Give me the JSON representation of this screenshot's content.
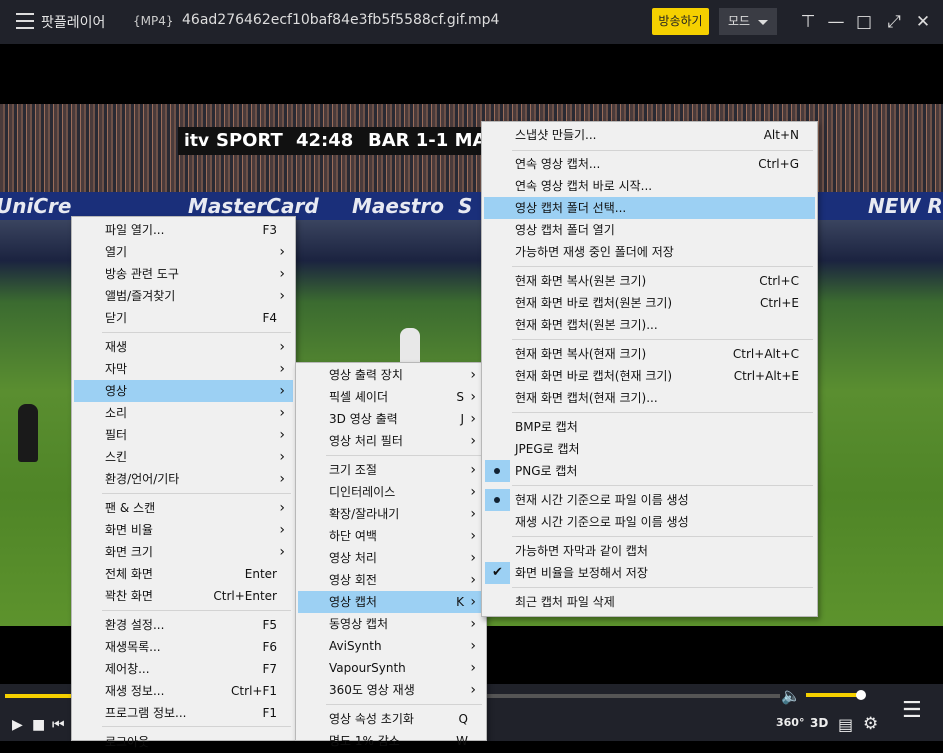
{
  "titlebar": {
    "app_name": "팟플레이어",
    "format": "{MP4}",
    "filename": "46ad276462ecf10baf84e3fb5f5588cf.gif.mp4",
    "broadcast_button": "방송하기",
    "mode_button": "모드"
  },
  "video": {
    "broadcaster": "itv",
    "sport_label": "SPORT",
    "clock": "42:48",
    "score": "BAR 1-1 MA",
    "ads": [
      "UniCre",
      "MasterCard",
      "Maestro",
      "S",
      "NEW R"
    ]
  },
  "menu_main": {
    "items": [
      {
        "label": "파일 열기...",
        "shortcut": "F3",
        "sub": false
      },
      {
        "label": "열기",
        "shortcut": "",
        "sub": true
      },
      {
        "label": "방송 관련 도구",
        "shortcut": "",
        "sub": true
      },
      {
        "label": "앨범/즐겨찾기",
        "shortcut": "",
        "sub": true
      },
      {
        "label": "닫기",
        "shortcut": "F4",
        "sub": false
      },
      {
        "label": "재생",
        "shortcut": "",
        "sub": true
      },
      {
        "label": "자막",
        "shortcut": "",
        "sub": true
      },
      {
        "label": "영상",
        "shortcut": "",
        "sub": true
      },
      {
        "label": "소리",
        "shortcut": "",
        "sub": true
      },
      {
        "label": "필터",
        "shortcut": "",
        "sub": true
      },
      {
        "label": "스킨",
        "shortcut": "",
        "sub": true
      },
      {
        "label": "환경/언어/기타",
        "shortcut": "",
        "sub": true
      },
      {
        "label": "팬 & 스캔",
        "shortcut": "",
        "sub": true
      },
      {
        "label": "화면 비율",
        "shortcut": "",
        "sub": true
      },
      {
        "label": "화면 크기",
        "shortcut": "",
        "sub": true
      },
      {
        "label": "전체 화면",
        "shortcut": "Enter",
        "sub": false
      },
      {
        "label": "꽉찬 화면",
        "shortcut": "Ctrl+Enter",
        "sub": false
      },
      {
        "label": "환경 설정...",
        "shortcut": "F5",
        "sub": false
      },
      {
        "label": "재생목록...",
        "shortcut": "F6",
        "sub": false
      },
      {
        "label": "제어창...",
        "shortcut": "F7",
        "sub": false
      },
      {
        "label": "재생 정보...",
        "shortcut": "Ctrl+F1",
        "sub": false
      },
      {
        "label": "프로그램 정보...",
        "shortcut": "F1",
        "sub": false
      },
      {
        "label": "로그아웃",
        "shortcut": "",
        "sub": false
      }
    ]
  },
  "menu_video": {
    "items": [
      {
        "label": "영상 출력 장치",
        "shortcut": "",
        "sub": true
      },
      {
        "label": "픽셀 셰이더",
        "shortcut": "S",
        "sub": true
      },
      {
        "label": "3D 영상 출력",
        "shortcut": "J",
        "sub": true
      },
      {
        "label": "영상 처리 필터",
        "shortcut": "",
        "sub": true
      },
      {
        "label": "크기 조절",
        "shortcut": "",
        "sub": true
      },
      {
        "label": "디인터레이스",
        "shortcut": "",
        "sub": true
      },
      {
        "label": "확장/잘라내기",
        "shortcut": "",
        "sub": true
      },
      {
        "label": "하단 여백",
        "shortcut": "",
        "sub": true
      },
      {
        "label": "영상 처리",
        "shortcut": "",
        "sub": true
      },
      {
        "label": "영상 회전",
        "shortcut": "",
        "sub": true
      },
      {
        "label": "영상 캡처",
        "shortcut": "K",
        "sub": true
      },
      {
        "label": "동영상 캡처",
        "shortcut": "",
        "sub": true
      },
      {
        "label": "AviSynth",
        "shortcut": "",
        "sub": true
      },
      {
        "label": "VapourSynth",
        "shortcut": "",
        "sub": true
      },
      {
        "label": "360도 영상 재생",
        "shortcut": "",
        "sub": true
      },
      {
        "label": "영상 속성 초기화",
        "shortcut": "Q",
        "sub": false
      },
      {
        "label": "명도 1% 감소",
        "shortcut": "W",
        "sub": false
      }
    ]
  },
  "menu_capture": {
    "items": [
      {
        "label": "스냅샷 만들기...",
        "shortcut": "Alt+N"
      },
      {
        "label": "연속 영상 캡처...",
        "shortcut": "Ctrl+G"
      },
      {
        "label": "연속 영상 캡처 바로 시작...",
        "shortcut": ""
      },
      {
        "label": "영상 캡처 폴더 선택...",
        "shortcut": ""
      },
      {
        "label": "영상 캡처 폴더 열기",
        "shortcut": ""
      },
      {
        "label": "가능하면 재생 중인 폴더에 저장",
        "shortcut": ""
      },
      {
        "label": "현재 화면 복사(원본 크기)",
        "shortcut": "Ctrl+C"
      },
      {
        "label": "현재 화면 바로 캡처(원본 크기)",
        "shortcut": "Ctrl+E"
      },
      {
        "label": "현재 화면 캡처(원본 크기)...",
        "shortcut": ""
      },
      {
        "label": "현재 화면 복사(현재 크기)",
        "shortcut": "Ctrl+Alt+C"
      },
      {
        "label": "현재 화면 바로 캡처(현재 크기)",
        "shortcut": "Ctrl+Alt+E"
      },
      {
        "label": "현재 화면 캡처(현재 크기)...",
        "shortcut": ""
      },
      {
        "label": "BMP로 캡처",
        "shortcut": ""
      },
      {
        "label": "JPEG로 캡처",
        "shortcut": ""
      },
      {
        "label": "PNG로 캡처",
        "shortcut": ""
      },
      {
        "label": "현재 시간 기준으로 파일 이름 생성",
        "shortcut": ""
      },
      {
        "label": "재생 시간 기준으로 파일 이름 생성",
        "shortcut": ""
      },
      {
        "label": "가능하면 자막과 같이 캡처",
        "shortcut": ""
      },
      {
        "label": "화면 비율을 보정해서 저장",
        "shortcut": ""
      },
      {
        "label": "최근 캡처 파일 삭제",
        "shortcut": ""
      }
    ]
  },
  "controls": {
    "badge_360": "360°",
    "badge_3d": "3D"
  },
  "colors": {
    "accent": "#f5d000",
    "highlight": "#9cd0f3"
  }
}
